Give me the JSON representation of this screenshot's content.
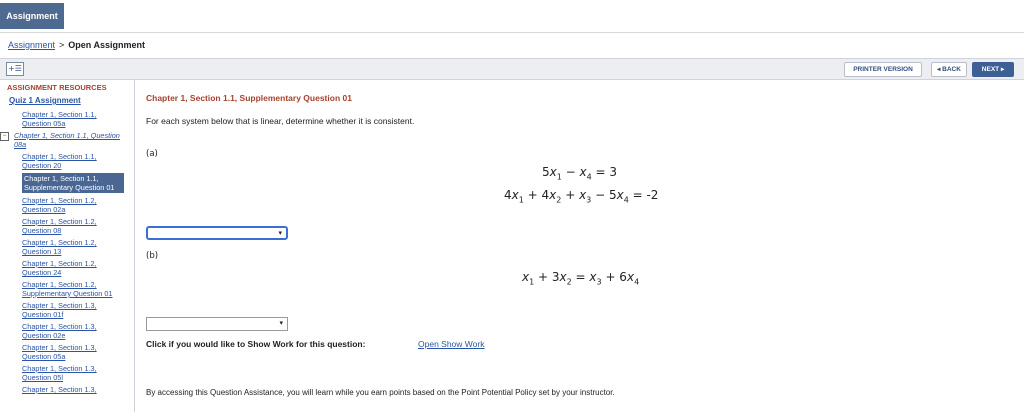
{
  "header": {
    "tab_label": "Assignment"
  },
  "breadcrumb": {
    "link": "Assignment",
    "separator": ">",
    "current": "Open Assignment"
  },
  "toolbar": {
    "printer_label": "PRINTER VERSION",
    "back_label": "◂ BACK",
    "next_label": "NEXT ▸"
  },
  "sidebar": {
    "heading": "ASSIGNMENT RESOURCES",
    "quiz_link": "Quiz 1 Assignment",
    "items": [
      {
        "label": "Chapter 1, Section 1.1, Question 05a"
      },
      {
        "label": "Chapter 1, Section 1.1, Question 08a"
      },
      {
        "label": "Chapter 1, Section 1.1, Question 20"
      },
      {
        "label": "Chapter 1, Section 1.1, Supplementary Question 01"
      },
      {
        "label": "Chapter 1, Section 1.2, Question 02a"
      },
      {
        "label": "Chapter 1, Section 1.2, Question 08"
      },
      {
        "label": "Chapter 1, Section 1.2, Question 13"
      },
      {
        "label": "Chapter 1, Section 1.2, Question 24"
      },
      {
        "label": "Chapter 1, Section 1.2, Supplementary Question 01"
      },
      {
        "label": "Chapter 1, Section 1.3, Question 01f"
      },
      {
        "label": "Chapter 1, Section 1.3, Question 02e"
      },
      {
        "label": "Chapter 1, Section 1.3, Question 05a"
      },
      {
        "label": "Chapter 1, Section 1.3, Question 05l"
      },
      {
        "label": "Chapter 1, Section 1.3,"
      }
    ]
  },
  "question": {
    "title": "Chapter 1, Section 1.1, Supplementary Question 01",
    "intro": "For each system below that is linear, determine whether it is consistent.",
    "part_a_label": "(a)",
    "part_b_label": "(b)",
    "show_work_prompt": "Click if you would like to Show Work for this question:",
    "show_work_link": "Open Show Work",
    "assistance_note": "By accessing this Question Assistance, you will learn while you earn points based on the Point Potential Policy set by your instructor."
  },
  "colors": {
    "accent": "#4f6a90",
    "title_red": "#a8412e",
    "link_blue": "#2a55a6",
    "focus_blue": "#3b6fd4"
  }
}
